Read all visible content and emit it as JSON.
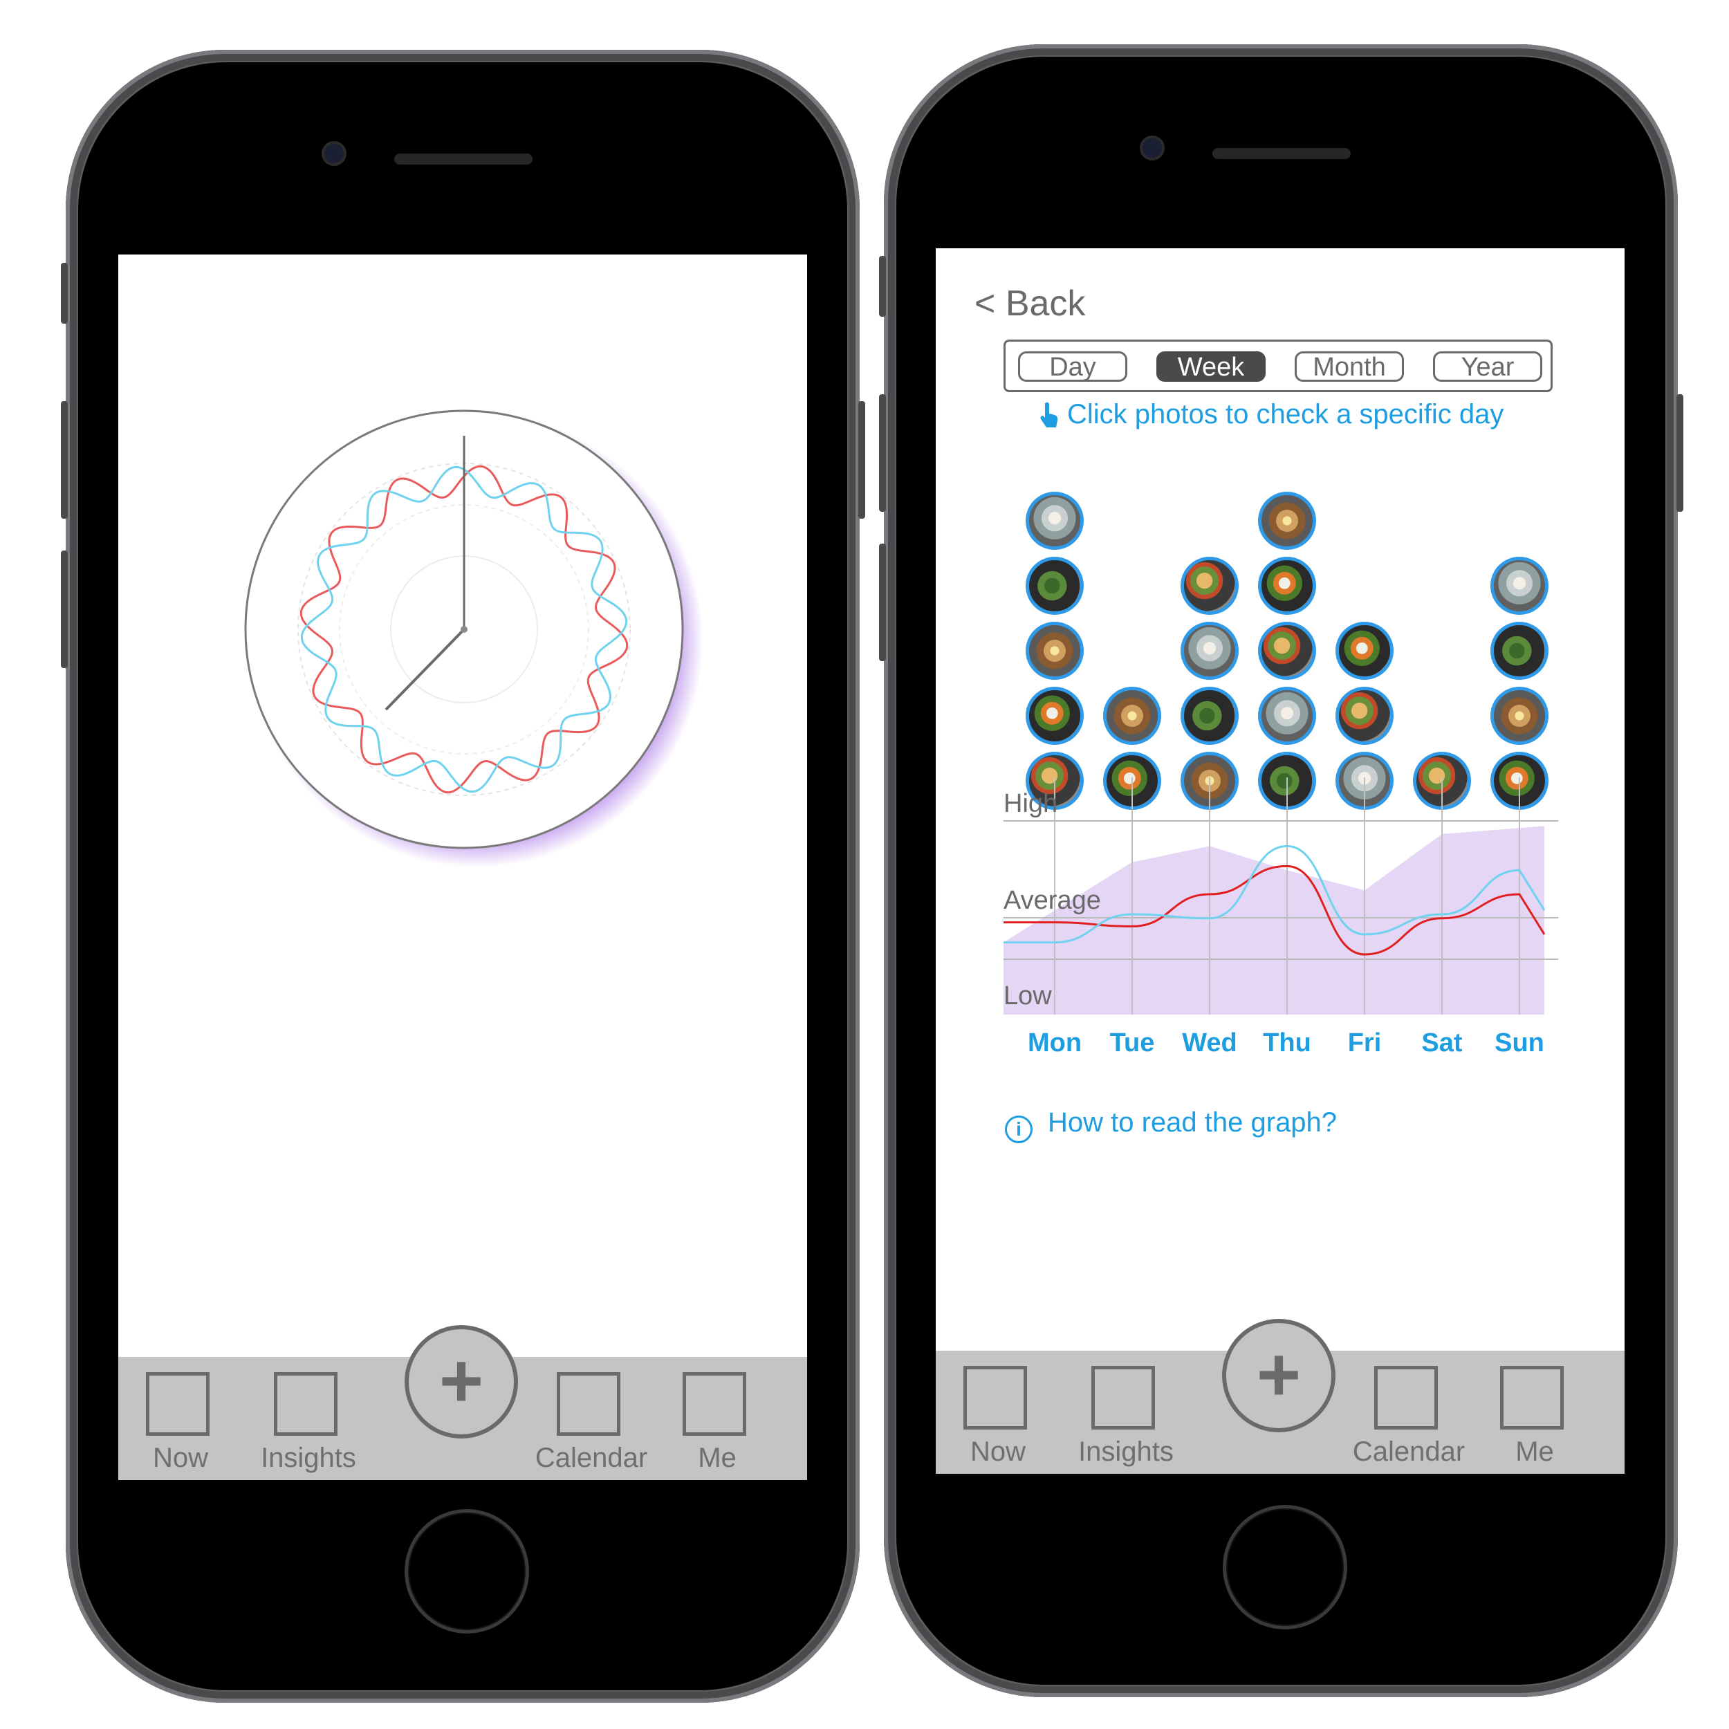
{
  "left_screen": {
    "tabbar": {
      "items": [
        {
          "label": "Now"
        },
        {
          "label": "Insights"
        },
        {
          "label": "Calendar"
        },
        {
          "label": "Me"
        }
      ],
      "add_symbol": "+"
    },
    "clock": {
      "hand_hour": "7",
      "hand_minute": "12"
    }
  },
  "right_screen": {
    "back_label": "< Back",
    "segments": [
      {
        "label": "Day",
        "active": false
      },
      {
        "label": "Week",
        "active": true
      },
      {
        "label": "Month",
        "active": false
      },
      {
        "label": "Year",
        "active": false
      }
    ],
    "hint": "Click photos to check a specific day",
    "info_link": "How to read the graph?",
    "tabbar": {
      "items": [
        {
          "label": "Now"
        },
        {
          "label": "Insights"
        },
        {
          "label": "Calendar"
        },
        {
          "label": "Me"
        }
      ],
      "add_symbol": "+"
    },
    "photo_counts": [
      5,
      2,
      4,
      5,
      3,
      1,
      4
    ],
    "chart_data": {
      "type": "line",
      "categories": [
        "Mon",
        "Tue",
        "Wed",
        "Thu",
        "Fri",
        "Sat",
        "Sun"
      ],
      "y_labels": [
        "High",
        "Average",
        "Low"
      ],
      "series": [
        {
          "color": "#e02020",
          "values": [
            0.46,
            0.44,
            0.6,
            0.74,
            0.3,
            0.48,
            0.6
          ]
        },
        {
          "color": "#6fd2ee",
          "values": [
            0.36,
            0.5,
            0.48,
            0.84,
            0.4,
            0.5,
            0.72
          ]
        }
      ],
      "area_color": "#e6d6f6",
      "ylim": [
        0,
        1
      ]
    }
  },
  "colors": {
    "accent": "#1e9ee0",
    "tabbar": "#c4c4c4",
    "active_segment": "#4a4a4a"
  }
}
